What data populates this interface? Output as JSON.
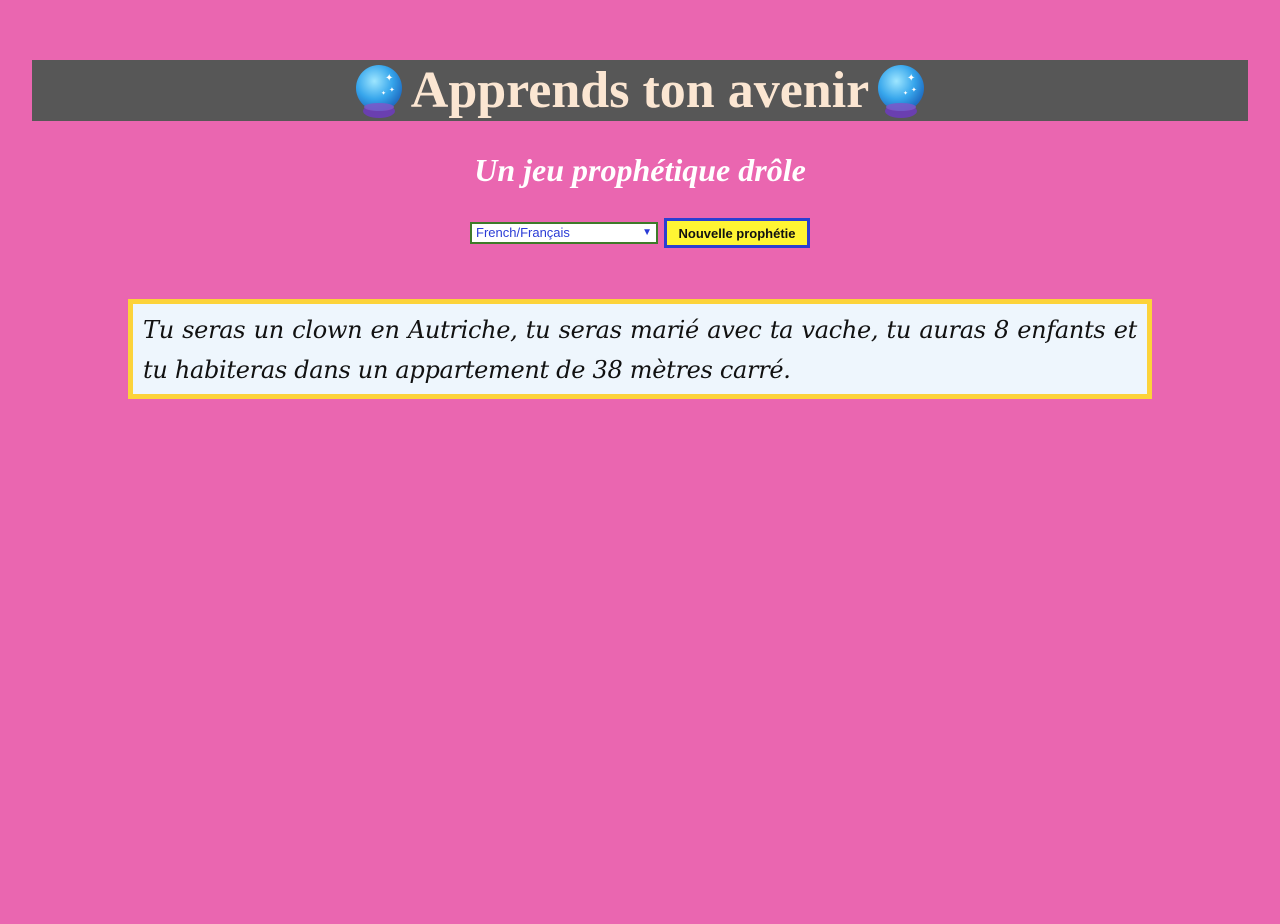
{
  "header": {
    "title": "Apprends ton avenir",
    "left_icon": "crystal-ball-icon",
    "right_icon": "crystal-ball-icon"
  },
  "subtitle": "Un jeu prophétique drôle",
  "controls": {
    "language_selected": "French/Français",
    "new_button_label": "Nouvelle prophétie"
  },
  "prophecy": {
    "text": "Tu seras un clown en Autriche, tu seras marié avec ta vache, tu auras 8 enfants et tu habiteras dans un appartement de 38 mètres carré."
  },
  "colors": {
    "background": "#ea66b0",
    "header_bg": "#575757",
    "title_color": "#fbe6d2",
    "button_bg": "#fff533",
    "button_border": "#2b3fd1",
    "box_border": "#fcd33a",
    "box_bg": "#eef6fd"
  }
}
